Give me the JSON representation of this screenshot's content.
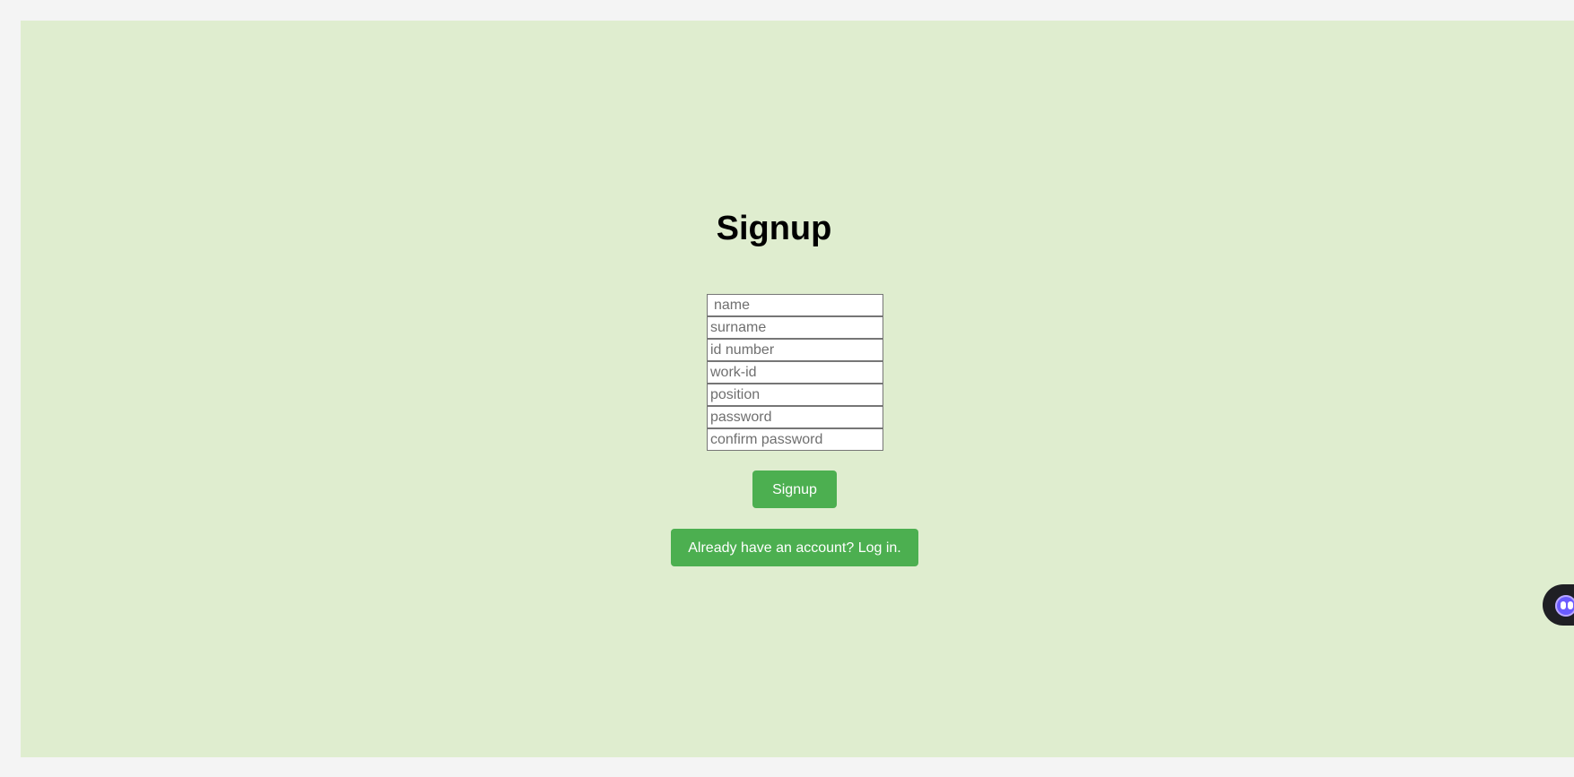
{
  "page": {
    "title": "Signup",
    "colors": {
      "background": "#f4f4f4",
      "panel": "#dfedcf",
      "accent": "#4caf50"
    }
  },
  "form": {
    "fields": [
      {
        "placeholder": "name"
      },
      {
        "placeholder": "surname"
      },
      {
        "placeholder": "id number"
      },
      {
        "placeholder": "work-id"
      },
      {
        "placeholder": "position"
      },
      {
        "placeholder": "password"
      },
      {
        "placeholder": "confirm password"
      }
    ],
    "submit_label": "Signup",
    "login_link_label": "Already have an account? Log in."
  },
  "widget": {
    "icon": "assistant-bot-icon"
  }
}
